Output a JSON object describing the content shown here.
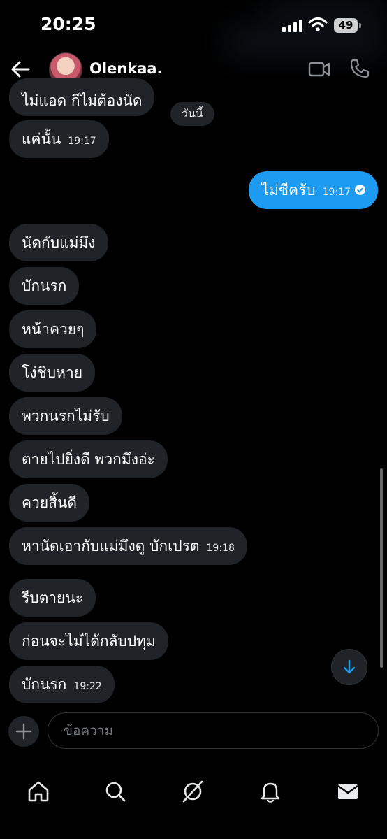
{
  "status": {
    "time": "20:25",
    "battery": "49"
  },
  "header": {
    "contact_name": "Olenkaa."
  },
  "date_chip": "วันนี้",
  "messages": [
    {
      "text": "ไม่แอด กีไม่ต้องนัด",
      "time": "",
      "from": "other"
    },
    {
      "text": "แค่นั้น",
      "time": "19:17",
      "from": "other"
    },
    {
      "text": "ไม่ชีครับ",
      "time": "19:17",
      "from": "me"
    },
    {
      "text": "นัดกับแม่มึง",
      "time": "",
      "from": "other"
    },
    {
      "text": "บักนรก",
      "time": "",
      "from": "other"
    },
    {
      "text": "หน้าควยๆ",
      "time": "",
      "from": "other"
    },
    {
      "text": "โง่ชิบหาย",
      "time": "",
      "from": "other"
    },
    {
      "text": "พวกนรกไม่รับ",
      "time": "",
      "from": "other"
    },
    {
      "text": "ตายไปยิ่งดี พวกมึงอ่ะ",
      "time": "",
      "from": "other"
    },
    {
      "text": "ควยสิ้นดี",
      "time": "",
      "from": "other"
    },
    {
      "text": "หานัดเอากับแม่มึงดู บักเปรต",
      "time": "19:18",
      "from": "other"
    },
    {
      "text": "รีบตายนะ",
      "time": "",
      "from": "other"
    },
    {
      "text": "ก่อนจะไม่ได้กลับปทุม",
      "time": "",
      "from": "other"
    },
    {
      "text": "บักนรก",
      "time": "19:22",
      "from": "other"
    }
  ],
  "composer": {
    "placeholder": "ข้อความ"
  },
  "colors": {
    "accent": "#1d9bf0",
    "bubble_other": "#202327",
    "background": "#000000"
  },
  "icons": [
    "back-arrow-icon",
    "video-call-icon",
    "phone-icon",
    "plus-icon",
    "arrow-down-icon",
    "home-icon",
    "search-icon",
    "grok-icon",
    "bell-icon",
    "mail-icon"
  ]
}
